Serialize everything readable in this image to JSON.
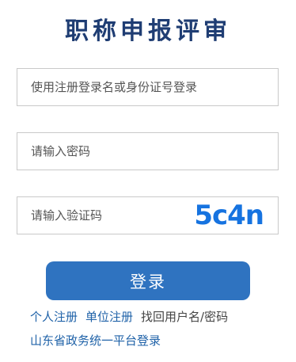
{
  "title": "职称申报评审",
  "fields": {
    "username_placeholder": "使用注册登录名或身份证号登录",
    "password_placeholder": "请输入密码",
    "captcha_placeholder": "请输入验证码",
    "captcha_text": "5c4n"
  },
  "login_button": "登录",
  "links": {
    "personal_register": "个人注册",
    "unit_register": "单位注册",
    "recover": "找回用户名/密码",
    "platform_login": "山东省政务统一平台登录"
  },
  "colors": {
    "title": "#1f3d73",
    "button": "#2f73c0",
    "link": "#1f62a8",
    "captcha": "#1673e0"
  }
}
